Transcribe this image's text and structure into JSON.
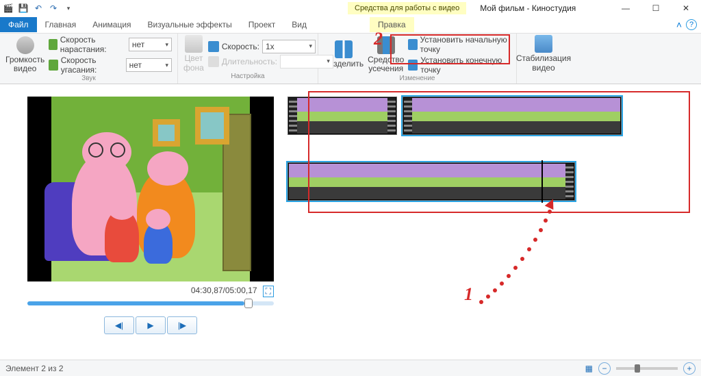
{
  "window": {
    "title": "Мой фильм - Киностудия",
    "contextual_tab": "Средства для работы с видео"
  },
  "tabs": {
    "file": "Файл",
    "home": "Главная",
    "animation": "Анимация",
    "visual_effects": "Визуальные эффекты",
    "project": "Проект",
    "view": "Вид",
    "edit": "Правка"
  },
  "ribbon": {
    "sound_group": "Звук",
    "settings_group": "Настройка",
    "change_group": "Изменение",
    "volume": "Громкость видео",
    "fade_in": "Скорость нарастания:",
    "fade_out": "Скорость угасания:",
    "fade_value": "нет",
    "bg_color": "Цвет фона",
    "speed": "Скорость:",
    "speed_value": "1x",
    "duration": "Длительность:",
    "split": "Разделить",
    "trim": "Средство усечения",
    "set_start": "Установить начальную точку",
    "set_end": "Установить конечную точку",
    "stabilize": "Стабилизация видео"
  },
  "preview": {
    "timecode": "04:30,87/05:00,17"
  },
  "status": {
    "element": "Элемент 2 из 2"
  },
  "annotations": {
    "one": "1",
    "two": "2"
  }
}
